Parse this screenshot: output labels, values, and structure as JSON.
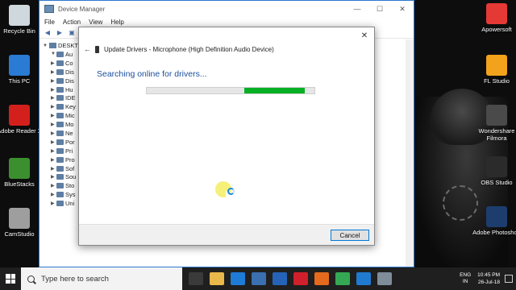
{
  "desktop": {
    "left_icons": [
      {
        "label": "Recycle Bin",
        "icon": "recycle-bin-icon",
        "color": "#cfd8dc"
      },
      {
        "label": "This PC",
        "icon": "computer-icon",
        "color": "#2a7bd4"
      },
      {
        "label": "Adobe Reader X",
        "icon": "adobe-reader-icon",
        "color": "#d4201c"
      },
      {
        "label": "BlueStacks",
        "icon": "bluestacks-icon",
        "color": "#3b8f2e"
      },
      {
        "label": "CamStudio",
        "icon": "camstudio-icon",
        "color": "#9e9e9e"
      }
    ],
    "right_icons": [
      {
        "label": "Apowersoft",
        "icon": "apowersoft-icon",
        "color": "#e53935"
      },
      {
        "label": "FL Studio",
        "icon": "fl-studio-icon",
        "color": "#f2a21b"
      },
      {
        "label": "Wondershare Filmora",
        "icon": "filmora-icon",
        "color": "#4a4a4a"
      },
      {
        "label": "OBS Studio",
        "icon": "obs-icon",
        "color": "#2b2b2b"
      },
      {
        "label": "Adobe Photoshop",
        "icon": "photoshop-icon",
        "color": "#1c3d6e"
      }
    ]
  },
  "device_manager": {
    "title": "Device Manager",
    "menu": [
      "File",
      "Action",
      "View",
      "Help"
    ],
    "root": "DESKT",
    "tree_items": [
      "Au",
      "Co",
      "Dis",
      "Dis",
      "Hu",
      "IDE",
      "Key",
      "Mic",
      "Mo",
      "Ne",
      "Por",
      "Pri",
      "Pro",
      "Sof",
      "Sou",
      "Sto",
      "Sys",
      "Uni"
    ]
  },
  "dialog": {
    "header": "Update Drivers - Microphone (High Definition Audio Device)",
    "heading": "Searching online for drivers...",
    "progress_fraction_start": 0.58,
    "progress_fraction_end": 0.94,
    "progress_color": "#06b025",
    "cancel_label": "Cancel"
  },
  "taskbar": {
    "search_placeholder": "Type here to search",
    "apps": [
      {
        "icon": "task-view-icon",
        "color": "#3a3a3a"
      },
      {
        "icon": "file-explorer-icon",
        "color": "#e8b84a"
      },
      {
        "icon": "edge-icon",
        "color": "#1e7bd6"
      },
      {
        "icon": "store-icon",
        "color": "#3a6fb0"
      },
      {
        "icon": "mail-icon",
        "color": "#2563b8"
      },
      {
        "icon": "opera-icon",
        "color": "#d1202c"
      },
      {
        "icon": "firefox-icon",
        "color": "#e66a1e"
      },
      {
        "icon": "chrome-icon",
        "color": "#35a853"
      },
      {
        "icon": "photos-icon",
        "color": "#1f7ad0"
      },
      {
        "icon": "device-manager-icon",
        "color": "#7f8c9a"
      }
    ],
    "lang_line1": "ENG",
    "lang_line2": "IN",
    "time": "10:45 PM",
    "date": "26-Jul-18"
  }
}
